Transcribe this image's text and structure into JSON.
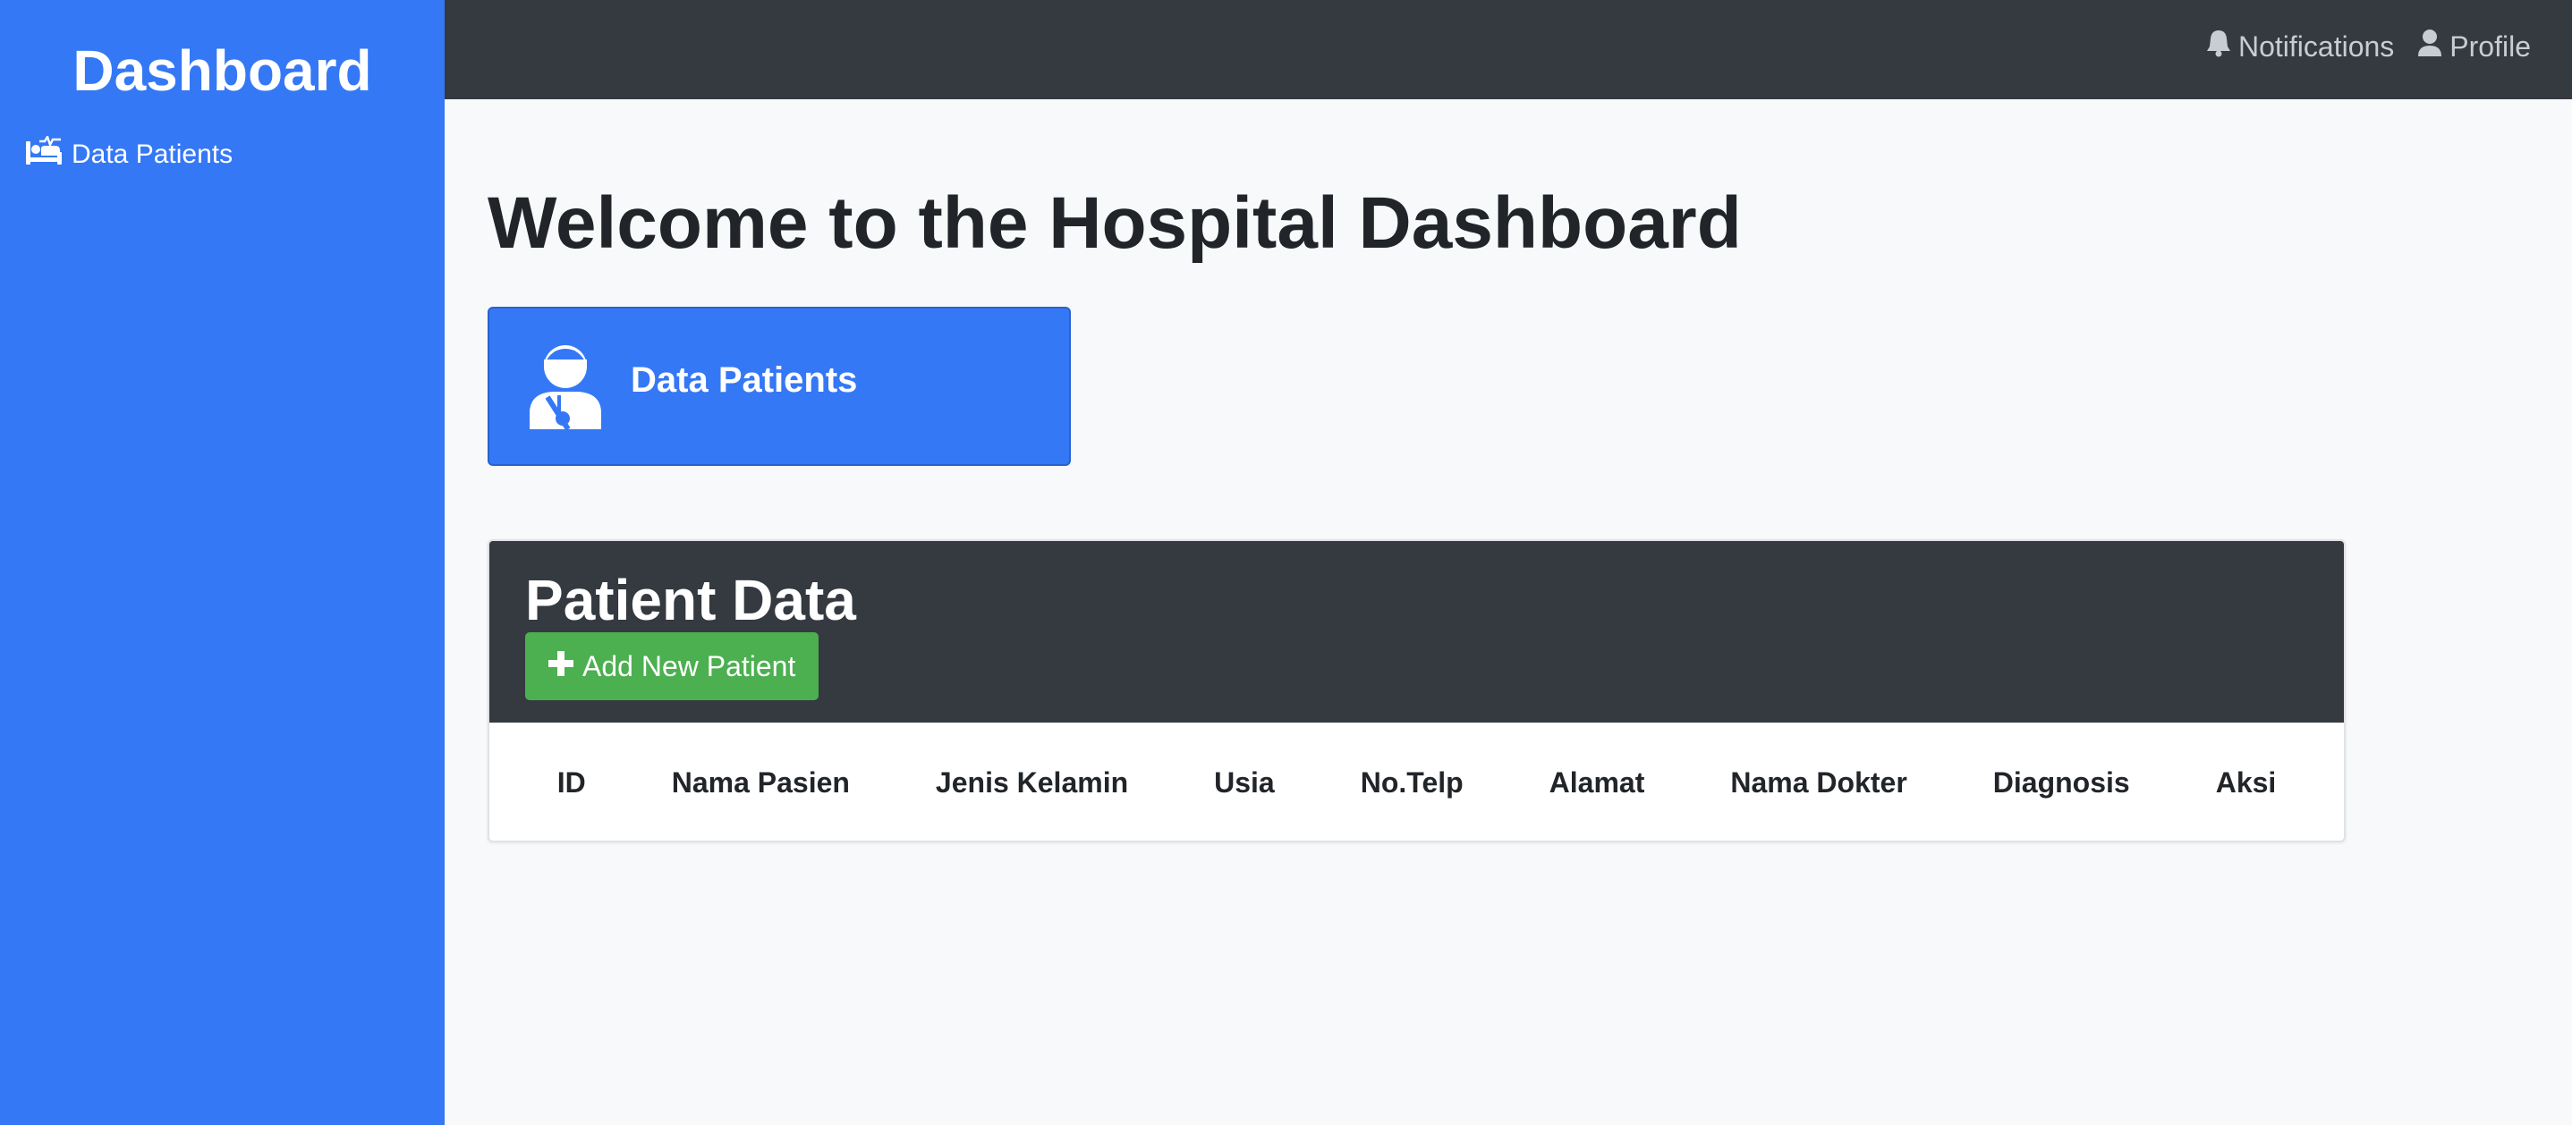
{
  "sidebar": {
    "title": "Dashboard",
    "items": [
      {
        "label": "Data Patients",
        "icon": "bed-pulse-icon"
      }
    ]
  },
  "topbar": {
    "links": [
      {
        "label": "Notifications",
        "icon": "bell-icon"
      },
      {
        "label": "Profile",
        "icon": "user-icon"
      }
    ]
  },
  "main": {
    "title": "Welcome to the Hospital Dashboard",
    "card": {
      "label": "Data Patients",
      "icon": "injured-patient-icon"
    }
  },
  "patient_panel": {
    "title": "Patient Data",
    "add_button_label": "Add New Patient",
    "columns": [
      "ID",
      "Nama Pasien",
      "Jenis Kelamin",
      "Usia",
      "No.Telp",
      "Alamat",
      "Nama Dokter",
      "Diagnosis",
      "Aksi"
    ]
  },
  "colors": {
    "primary": "#3578f6",
    "dark": "#343a40",
    "success": "#4caf50",
    "background": "#f8f9fa"
  }
}
